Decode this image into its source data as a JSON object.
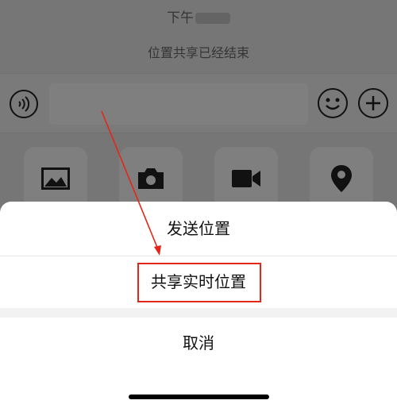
{
  "chat": {
    "time_label": "下午",
    "system_message": "位置共享已经结束"
  },
  "input_bar": {
    "voice_icon": "voice-icon",
    "emoji_icon": "emoji-icon",
    "plus_icon": "plus-icon"
  },
  "tools": [
    {
      "icon": "image-icon"
    },
    {
      "icon": "camera-icon"
    },
    {
      "icon": "video-icon"
    },
    {
      "icon": "location-icon"
    }
  ],
  "action_sheet": {
    "send_location": "发送位置",
    "share_live_location": "共享实时位置",
    "cancel": "取消"
  },
  "colors": {
    "highlight": "#e2261b",
    "overlay": "rgba(0,0,0,0.5)"
  }
}
